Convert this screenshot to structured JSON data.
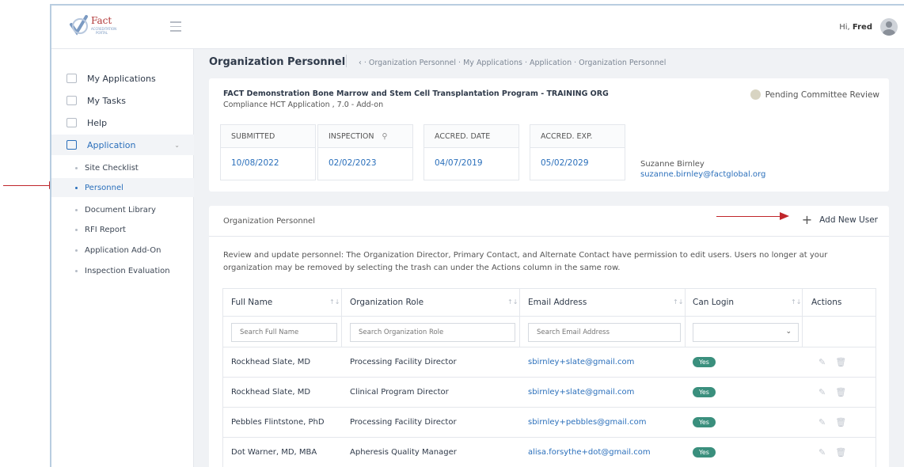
{
  "header": {
    "logo_text": "Fact",
    "logo_sub": "ACCREDITATION PORTAL",
    "greeting": "Hi,",
    "user_name": "Fred"
  },
  "sidebar": {
    "items": [
      {
        "label": "My Applications"
      },
      {
        "label": "My Tasks"
      },
      {
        "label": "Help"
      },
      {
        "label": "Application"
      }
    ],
    "sub_items": [
      {
        "label": "Site Checklist"
      },
      {
        "label": "Personnel"
      },
      {
        "label": "Document Library"
      },
      {
        "label": "RFI Report"
      },
      {
        "label": "Application Add-On"
      },
      {
        "label": "Inspection Evaluation"
      }
    ]
  },
  "page": {
    "title": "Organization Personnel",
    "breadcrumb": "‹  ·  Organization Personnel  ·  My Applications  ·  Application  ·  Organization Personnel"
  },
  "program": {
    "name": "FACT Demonstration Bone Marrow and Stem Cell Transplantation Program - TRAINING ORG",
    "subtitle": "Compliance HCT Application , 7.0 - Add-on",
    "status": "Pending Committee Review",
    "dates": [
      {
        "label": "SUBMITTED",
        "value": "10/08/2022"
      },
      {
        "label": "INSPECTION",
        "value": "02/02/2023"
      },
      {
        "label": "ACCRED. DATE",
        "value": "04/07/2019"
      },
      {
        "label": "ACCRED. EXP.",
        "value": "05/02/2029"
      }
    ],
    "contact_name": "Suzanne Birnley",
    "contact_email": "suzanne.birnley@factglobal.org"
  },
  "personnel": {
    "title": "Organization Personnel",
    "add_label": "Add New User",
    "description": "Review and update personnel: The Organization Director, Primary Contact, and Alternate Contact have permission to edit users. Users no longer at your organization may be removed by selecting the trash can under the Actions column in the same row.",
    "columns": [
      "Full Name",
      "Organization Role",
      "Email Address",
      "Can Login",
      "Actions"
    ],
    "filters": {
      "name": "Search Full Name",
      "role": "Search Organization Role",
      "email": "Search Email Address"
    },
    "rows": [
      {
        "name": "Rockhead Slate, MD",
        "role": "Processing Facility Director",
        "email": "sbirnley+slate@gmail.com",
        "login": "Yes"
      },
      {
        "name": "Rockhead Slate, MD",
        "role": "Clinical Program Director",
        "email": "sbirnley+slate@gmail.com",
        "login": "Yes"
      },
      {
        "name": "Pebbles Flintstone, PhD",
        "role": "Processing Facility Director",
        "email": "sbirnley+pebbles@gmail.com",
        "login": "Yes"
      },
      {
        "name": "Dot Warner, MD, MBA",
        "role": "Apheresis Quality Manager",
        "email": "alisa.forsythe+dot@gmail.com",
        "login": "Yes"
      }
    ]
  },
  "colors": {
    "accent": "#2a6fbb",
    "badge": "#3a8f7d",
    "annotation_arrow": "#c0262b"
  }
}
